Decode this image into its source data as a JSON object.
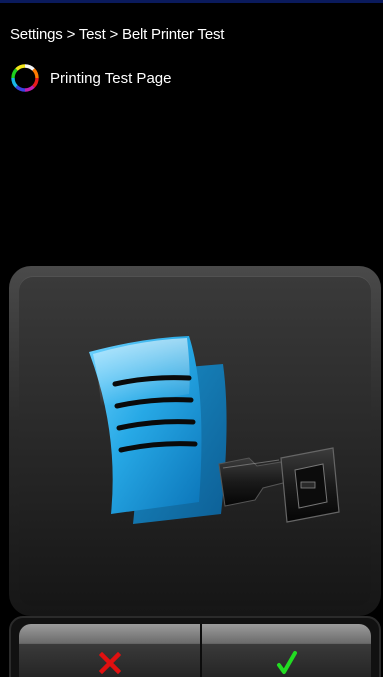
{
  "header": {
    "breadcrumb": "Settings > Test > Belt Printer Test"
  },
  "status": {
    "text": "Printing Test Page",
    "icon": "busy-spinner-icon"
  },
  "main": {
    "graphic": "belt-printer-icon"
  },
  "buttons": {
    "cancel_icon": "cancel-x-icon",
    "confirm_icon": "confirm-check-icon",
    "cancel_color": "#e01010",
    "confirm_color": "#22dd22"
  },
  "colors": {
    "background": "#000000",
    "header_border": "#0a1a5c",
    "document_blue": "#27a9e6"
  }
}
